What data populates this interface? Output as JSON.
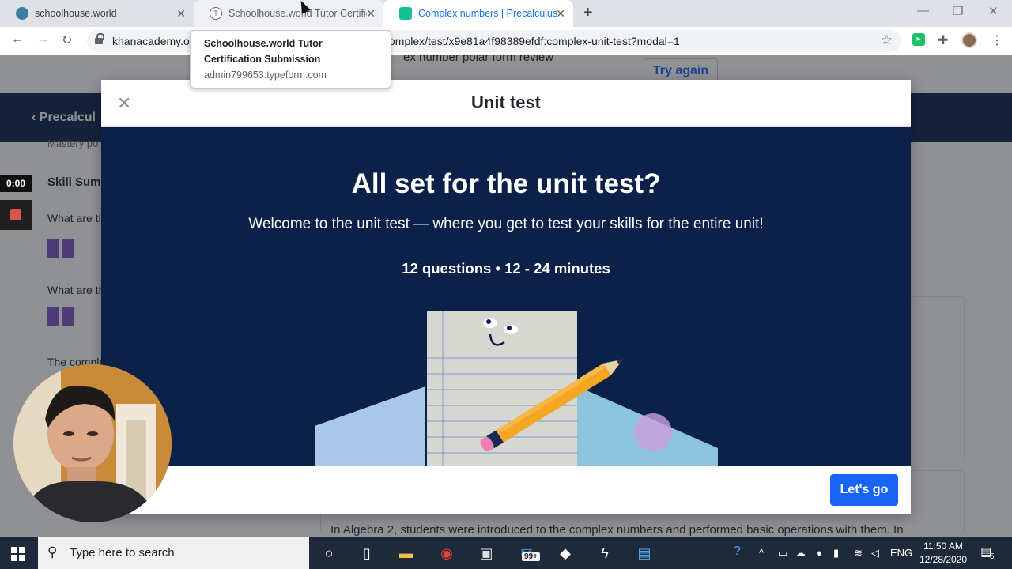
{
  "browser": {
    "tabs": [
      {
        "title": "schoolhouse.world",
        "favicon_color": "#3d7ea6"
      },
      {
        "title": "Schoolhouse.world Tutor Certific",
        "favicon_color": "#ffffff"
      },
      {
        "title": "Complex numbers | Precalculus |",
        "favicon_color": "#14bf96"
      }
    ],
    "url_left": "khanacademy.or",
    "url_right": "omplex/test/x9e81a4f98389efdf:complex-unit-test?modal=1",
    "tooltip": {
      "title": "Schoolhouse.world Tutor Certification Submission",
      "domain": "admin799653.typeform.com"
    }
  },
  "page": {
    "try_again": "Try again",
    "polar_text": "ex number polar form review",
    "breadcrumb": "Precalcul",
    "mastery": "Mastery po",
    "skill_summary": "Skill Summ",
    "q1": "What are th",
    "q2": "What are th",
    "complex": "The comple",
    "algebra": "In Algebra 2, students were introduced to the complex numbers and performed basic operations with them. In"
  },
  "recorder": {
    "timer": "0:00"
  },
  "modal": {
    "title": "Unit test",
    "heading": "All set for the unit test?",
    "subtitle": "Welcome to the unit test — where you get to test your skills for the entire unit!",
    "meta": "12 questions • 12 - 24 minutes",
    "go_label": "Let's go",
    "accent": "#1865f2",
    "hero_bg": "#0b2149"
  },
  "taskbar": {
    "search_placeholder": "Type here to search",
    "mail_badge": "99+",
    "lang": "ENG",
    "time": "11:50 AM",
    "date": "12/28/2020",
    "notif_count": "5"
  }
}
